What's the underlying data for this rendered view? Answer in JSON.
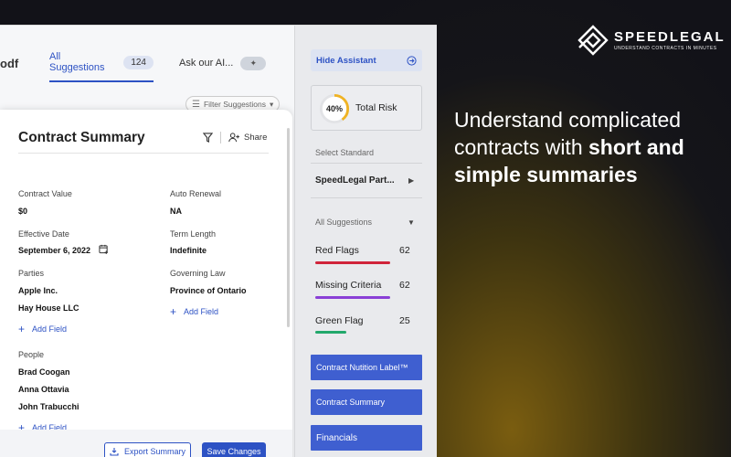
{
  "brand": {
    "name": "SPEEDLEGAL",
    "tagline": "UNDERSTAND CONTRACTS IN MINUTES",
    "accent": "#2d52c4"
  },
  "headline": {
    "normal": "Understand complicated contracts with ",
    "bold": "short and simple summaries"
  },
  "document": {
    "name_fragment": "odf"
  },
  "tabs": [
    {
      "label": "All Suggestions",
      "count": "124"
    },
    {
      "label": "Ask our AI..."
    }
  ],
  "filter": {
    "label": "Filter Suggestions"
  },
  "summary": {
    "title": "Contract Summary",
    "share_label": "Share",
    "contract_value": {
      "label": "Contract Value",
      "value": "$0"
    },
    "auto_renewal": {
      "label": "Auto Renewal",
      "value": "NA"
    },
    "effective_date": {
      "label": "Effective Date",
      "value": "September 6, 2022"
    },
    "term_length": {
      "label": "Term Length",
      "value": "Indefinite"
    },
    "parties": {
      "label": "Parties",
      "values": [
        "Apple Inc.",
        "Hay House LLC"
      ]
    },
    "governing_law": {
      "label": "Governing Law",
      "value": "Province of Ontario"
    },
    "people": {
      "label": "People",
      "values": [
        "Brad Coogan",
        "Anna Ottavia",
        "John Trabucchi"
      ]
    },
    "add_field_label": "Add Field",
    "export_label": "Export Summary",
    "save_label": "Save Changes"
  },
  "assistant": {
    "hide_label": "Hide Assistant",
    "risk": {
      "percent": "40%",
      "fraction": 0.4,
      "label": "Total Risk"
    },
    "standard_label": "Select Standard",
    "standard_value": "SpeedLegal Part...",
    "suggestions_dropdown": "All Suggestions",
    "categories": [
      {
        "name": "Red Flags",
        "count": "62",
        "color": "#d0243a"
      },
      {
        "name": "Missing Criteria",
        "count": "62",
        "color": "#8a3fd6"
      },
      {
        "name": "Green Flag",
        "count": "25",
        "color": "#22a86b"
      }
    ],
    "nav": [
      "Contract Nutition Label™",
      "Contract Summary",
      "Financials"
    ]
  }
}
